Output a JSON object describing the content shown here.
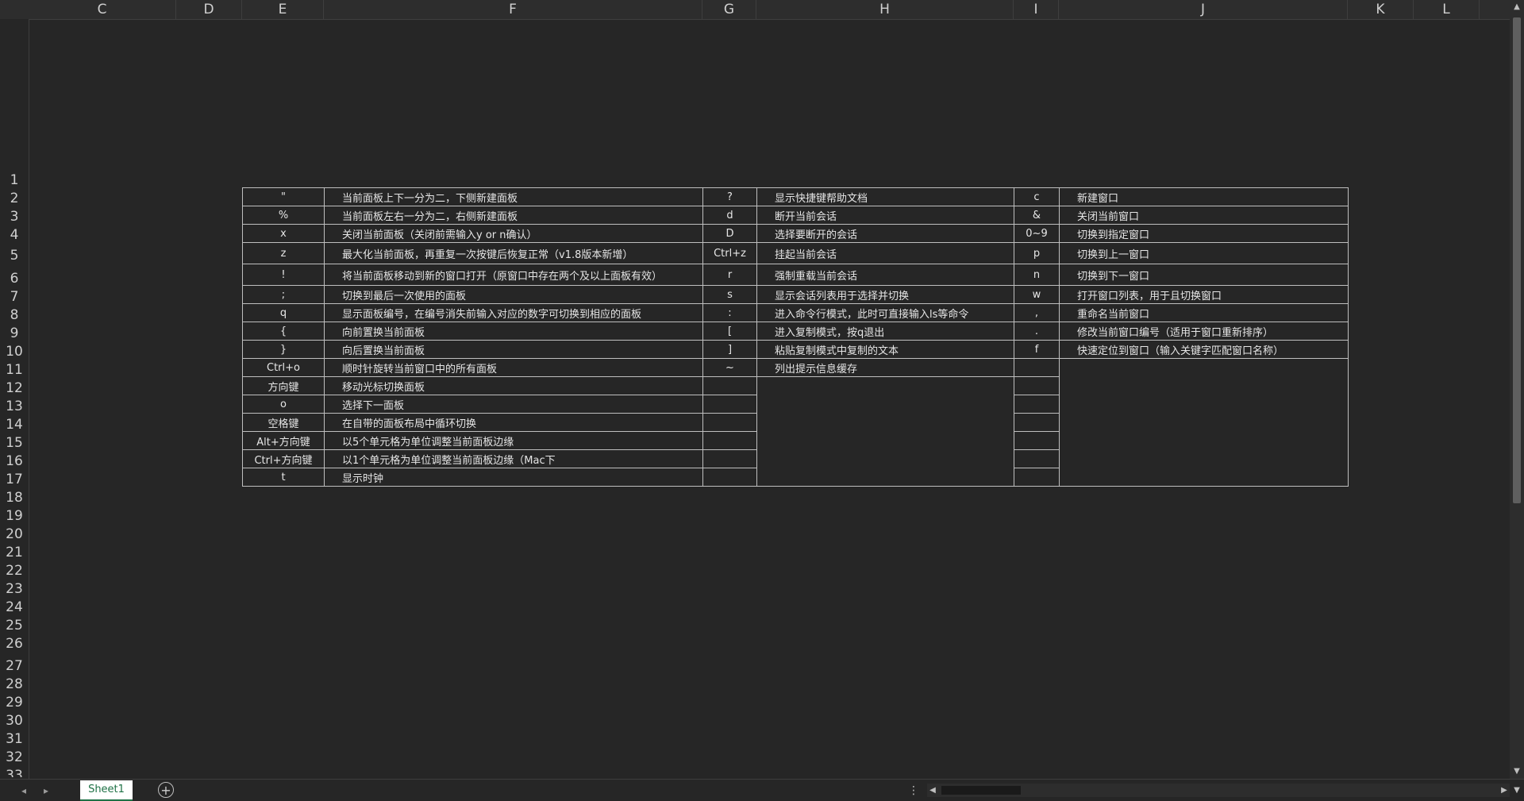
{
  "column_headers": [
    "C",
    "D",
    "E",
    "F",
    "G",
    "H",
    "I",
    "J",
    "K",
    "L"
  ],
  "row_headers": [
    "1",
    "2",
    "3",
    "4",
    "5",
    "6",
    "7",
    "8",
    "9",
    "10",
    "11",
    "12",
    "13",
    "14",
    "15",
    "16",
    "17",
    "18",
    "19",
    "20",
    "21",
    "22",
    "23",
    "24",
    "25",
    "26",
    "27",
    "28",
    "29",
    "30",
    "31",
    "32",
    "33"
  ],
  "table": {
    "rows": [
      {
        "k1": "\"",
        "d1": "当前面板上下一分为二，下侧新建面板",
        "k2": "?",
        "d2": "显示快捷键帮助文档",
        "k3": "c",
        "d3": "新建窗口"
      },
      {
        "k1": "%",
        "d1": "当前面板左右一分为二，右侧新建面板",
        "k2": "d",
        "d2": "断开当前会话",
        "k3": "&",
        "d3": "关闭当前窗口"
      },
      {
        "k1": "x",
        "d1": "关闭当前面板（关闭前需输入y or n确认）",
        "k2": "D",
        "d2": "选择要断开的会话",
        "k3": "0~9",
        "d3": "切换到指定窗口"
      },
      {
        "k1": "z",
        "d1": "最大化当前面板，再重复一次按键后恢复正常（v1.8版本新增）",
        "k2": "Ctrl+z",
        "d2": "挂起当前会话",
        "k3": "p",
        "d3": "切换到上一窗口"
      },
      {
        "k1": "!",
        "d1": "将当前面板移动到新的窗口打开（原窗口中存在两个及以上面板有效）",
        "k2": "r",
        "d2": "强制重载当前会话",
        "k3": "n",
        "d3": "切换到下一窗口"
      },
      {
        "k1": ";",
        "d1": "切换到最后一次使用的面板",
        "k2": "s",
        "d2": "显示会话列表用于选择并切换",
        "k3": "w",
        "d3": "打开窗口列表，用于且切换窗口"
      },
      {
        "k1": "q",
        "d1": "显示面板编号，在编号消失前输入对应的数字可切换到相应的面板",
        "k2": ":",
        "d2": "进入命令行模式，此时可直接输入ls等命令",
        "k3": ",",
        "d3": "重命名当前窗口"
      },
      {
        "k1": "{",
        "d1": "向前置换当前面板",
        "k2": "[",
        "d2": "进入复制模式，按q退出",
        "k3": ".",
        "d3": "修改当前窗口编号（适用于窗口重新排序）"
      },
      {
        "k1": "}",
        "d1": "向后置换当前面板",
        "k2": "]",
        "d2": "粘贴复制模式中复制的文本",
        "k3": "f",
        "d3": "快速定位到窗口（输入关键字匹配窗口名称）"
      },
      {
        "k1": "Ctrl+o",
        "d1": "顺时针旋转当前窗口中的所有面板",
        "k2": "~",
        "d2": "列出提示信息缓存",
        "k3": "",
        "d3": ""
      },
      {
        "k1": "方向键",
        "d1": "移动光标切换面板",
        "k2": "",
        "d2": "",
        "k3": "",
        "d3": ""
      },
      {
        "k1": "o",
        "d1": "选择下一面板",
        "k2": "",
        "d2": "",
        "k3": "",
        "d3": ""
      },
      {
        "k1": "空格键",
        "d1": "在自带的面板布局中循环切换",
        "k2": "",
        "d2": "",
        "k3": "",
        "d3": ""
      },
      {
        "k1": "Alt+方向键",
        "d1": "以5个单元格为单位调整当前面板边缘",
        "k2": "",
        "d2": "",
        "k3": "",
        "d3": ""
      },
      {
        "k1": "Ctrl+方向键",
        "d1": "以1个单元格为单位调整当前面板边缘（Mac下",
        "k2": "",
        "d2": "",
        "k3": "",
        "d3": ""
      },
      {
        "k1": "t",
        "d1": "显示时钟",
        "k2": "",
        "d2": "",
        "k3": "",
        "d3": ""
      }
    ]
  },
  "sheet_tab": "Sheet1",
  "icons": {
    "prev_sheet": "chevron-left-icon",
    "next_sheet": "chevron-right-icon",
    "add_sheet": "plus-circle-icon",
    "more": "vertical-dots-icon"
  },
  "colors": {
    "background": "#262626",
    "tab_accent": "#1e7145"
  }
}
